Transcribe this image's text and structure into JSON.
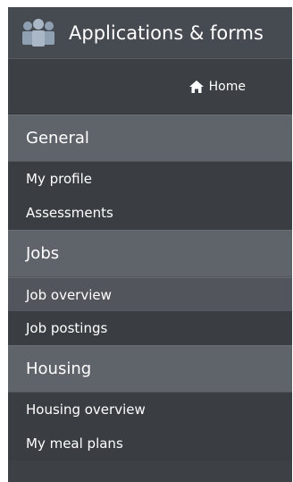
{
  "header": {
    "title": "Applications & forms",
    "icon": "people-group-icon"
  },
  "home": {
    "label": "Home",
    "icon": "home-icon"
  },
  "sections": [
    {
      "title": "General",
      "items": [
        {
          "label": "My profile"
        },
        {
          "label": "Assessments"
        }
      ]
    },
    {
      "title": "Jobs",
      "items": [
        {
          "label": "Job overview",
          "highlighted": true
        },
        {
          "label": "Job postings"
        }
      ]
    },
    {
      "title": "Housing",
      "items": [
        {
          "label": "Housing overview"
        },
        {
          "label": "My meal plans"
        }
      ]
    }
  ],
  "colors": {
    "panel": "#3d4146",
    "section_header": "#5f646b",
    "text": "#ffffff",
    "icon": "#8fa0b3"
  }
}
